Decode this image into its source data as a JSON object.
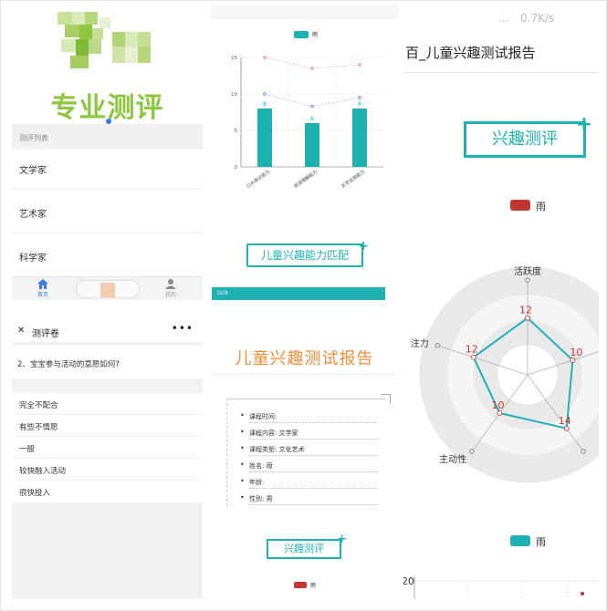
{
  "panel_home": {
    "app_title": "专业测评",
    "section_header": "测评列表",
    "list_items": [
      "文学家",
      "艺术家",
      "科学家"
    ],
    "tabs": [
      {
        "label": "首页",
        "icon": "home-icon"
      },
      {
        "label": "我的",
        "icon": "user-icon"
      }
    ],
    "colors": {
      "brand": "#8dc63f",
      "tab_active": "#3a7be0"
    }
  },
  "panel_quiz": {
    "nav_title": "测评卷",
    "more_label": "•••",
    "question": "2、宝宝参与活动的意愿如何?",
    "options": [
      "完全不配合",
      "有些不情愿",
      "一般",
      "较快融入活动",
      "很快投入"
    ]
  },
  "panel_bar": {
    "legend": "雨",
    "button_label": "儿童兴趣能力匹配",
    "level_label": "LV.9",
    "chart_data": {
      "type": "bar",
      "categories": [
        "口头表达能力",
        "阅读理解能力",
        "文字运用能力"
      ],
      "series": [
        {
          "name": "雨",
          "values": [
            8,
            6,
            8
          ]
        }
      ],
      "line_max": [
        15,
        13.5,
        14
      ],
      "line_avg": [
        10,
        8.3,
        9.5
      ],
      "ylim": [
        0,
        15
      ],
      "yticks": [
        0,
        5,
        10,
        15
      ],
      "data_labels": [
        "8",
        "6",
        "8"
      ],
      "bar_color": "#1eb1b1"
    }
  },
  "panel_report": {
    "title": "儿童兴趣测试报告",
    "fields": [
      "课程时间:",
      "课程内容: 文学家",
      "课程类型: 文化艺术",
      "姓名: 雨",
      "年龄:",
      "性别: 男"
    ],
    "button_label": "兴趣测评",
    "legend": "雨"
  },
  "panel_radar": {
    "status_dots": "...",
    "status_net": "0.7K/s",
    "title": "百_儿童兴趣测试报告",
    "button_label": "兴趣测评",
    "legend_top": "雨",
    "legend_bottom": "雨",
    "axis_value": "20",
    "chart_data": {
      "type": "radar",
      "indicators": [
        "活跃度",
        "",
        "",
        "主动性",
        "注力"
      ],
      "values": [
        12,
        10,
        14,
        10,
        12
      ],
      "value_labels": [
        "12",
        "10",
        "14",
        "10",
        "12"
      ],
      "series_name": "雨",
      "line_color": "#1eb1b1",
      "label_color": "#c23531"
    }
  }
}
